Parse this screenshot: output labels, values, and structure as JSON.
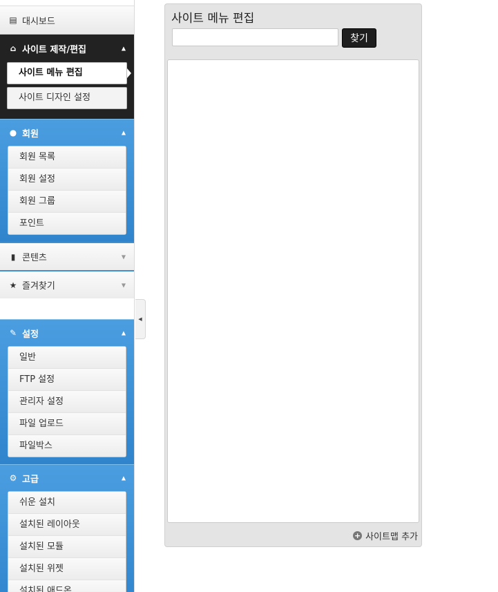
{
  "sidebar": {
    "dashboard": {
      "label": "대시보드",
      "icon": "dashboard-icon"
    },
    "site_edit": {
      "label": "사이트 제작/편집",
      "icon": "home-icon",
      "items": [
        "사이트 메뉴 편집",
        "사이트 디자인 설정"
      ],
      "active": "사이트 메뉴 편집"
    },
    "member": {
      "label": "회원",
      "icon": "user-icon",
      "items": [
        "회원 목록",
        "회원 설정",
        "회원 그룹",
        "포인트"
      ]
    },
    "contents": {
      "label": "콘텐츠",
      "icon": "book-icon"
    },
    "favorites": {
      "label": "즐겨찾기",
      "icon": "star-icon"
    },
    "settings": {
      "label": "설정",
      "icon": "wrench-icon",
      "items": [
        "일반",
        "FTP 설정",
        "관리자 설정",
        "파일 업로드",
        "파일박스"
      ]
    },
    "advanced": {
      "label": "고급",
      "icon": "gear-icon",
      "items": [
        "쉬운 설치",
        "설치된 레이아웃",
        "설치된 모듈",
        "설치된 위젯",
        "설치된 애드온"
      ]
    }
  },
  "panel": {
    "title": "사이트 메뉴 편집",
    "search": {
      "value": "",
      "button": "찾기"
    },
    "sitemap_add": "사이트맵 추가"
  },
  "colors": {
    "sidebar_blue": "#3a8fd3",
    "dark_header": "#222222",
    "panel_bg": "#e4e4e4"
  }
}
